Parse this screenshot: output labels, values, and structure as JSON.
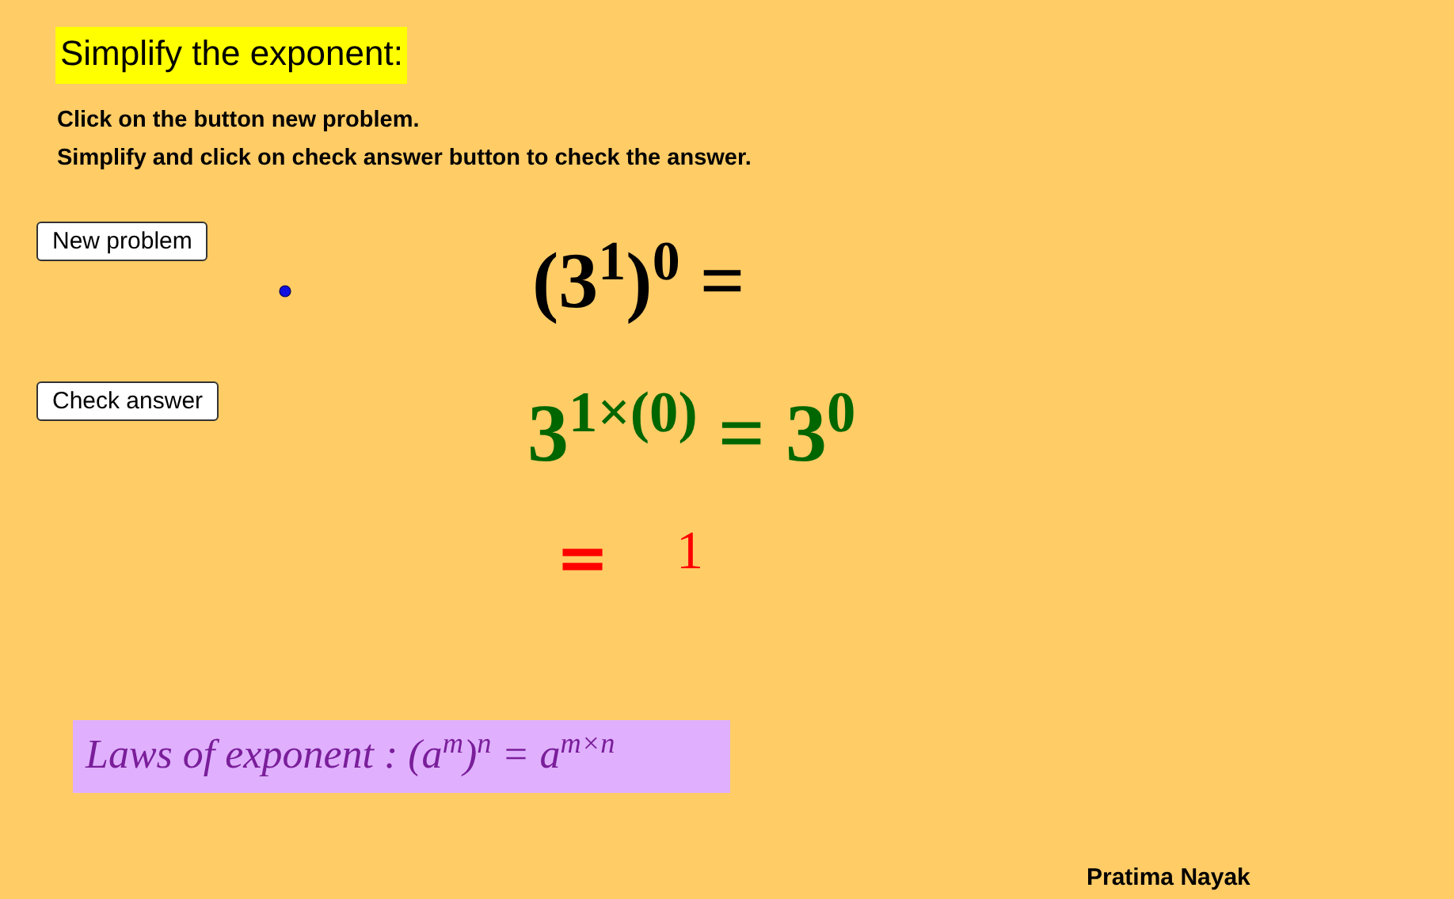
{
  "title": "Simplify the exponent:",
  "instructions": [
    "Click on the button new problem.",
    "Simplify and click on check answer button to check the answer."
  ],
  "buttons": [
    "New problem",
    "Check answer"
  ],
  "expression": "(3$^{1}$)$^{0}$ =",
  "step": "3$^{1×(0)}$ = 3$^{0}$",
  "result": {
    "equals": "=",
    "value": "1"
  },
  "law": "Laws of exponent : (a$^{m}$)$^{n}$ = a$^{m×n}$",
  "author": "Pratima Nayak"
}
